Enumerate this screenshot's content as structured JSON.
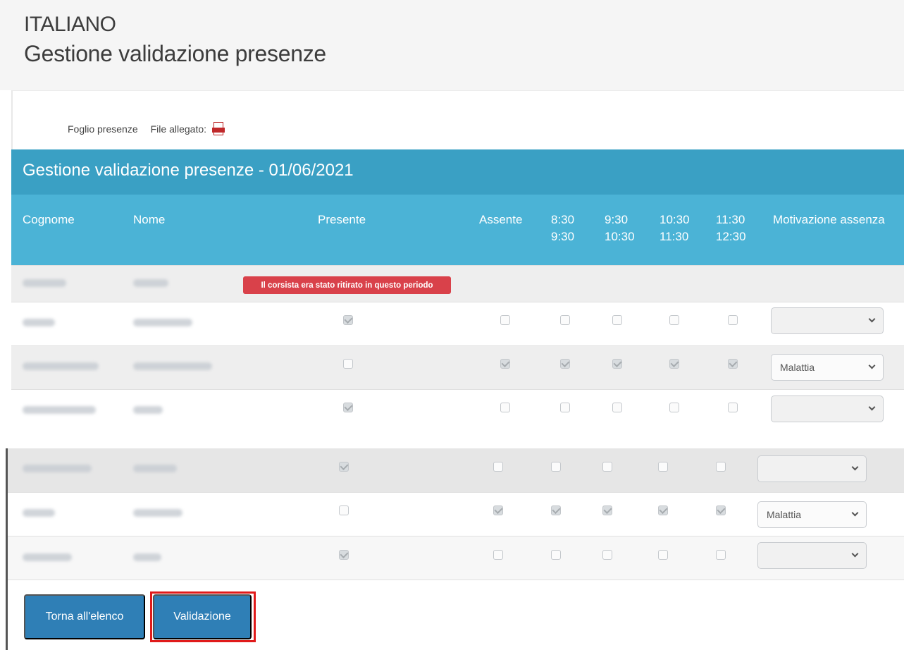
{
  "header": {
    "module": "ITALIANO",
    "title": "Gestione validazione presenze"
  },
  "files": {
    "sheet_label": "Foglio presenze",
    "attached_label": "File allegato:",
    "attached_icon": "pdf-icon"
  },
  "panel": {
    "title": "Gestione validazione presenze - 01/06/2021"
  },
  "columns": {
    "cognome": "Cognome",
    "nome": "Nome",
    "presente": "Presente",
    "assente": "Assente",
    "slots": [
      {
        "from": "8:30",
        "to": "9:30"
      },
      {
        "from": "9:30",
        "to": "10:30"
      },
      {
        "from": "10:30",
        "to": "11:30"
      },
      {
        "from": "11:30",
        "to": "12:30"
      }
    ],
    "motivazione": "Motivazione assenza"
  },
  "rows": [
    {
      "withdrawn": true,
      "badge": "Il corsista era stato ritirato in questo periodo"
    },
    {
      "presente": true,
      "assente": false,
      "slots": [
        false,
        false,
        false,
        false
      ],
      "motivazione": ""
    },
    {
      "presente": false,
      "assente": true,
      "slots": [
        true,
        true,
        true,
        true
      ],
      "motivazione": "Malattia"
    },
    {
      "presente": true,
      "assente": false,
      "slots": [
        false,
        false,
        false,
        false
      ],
      "motivazione": ""
    },
    {
      "presente": true,
      "assente": false,
      "slots": [
        false,
        false,
        false,
        false
      ],
      "motivazione": ""
    },
    {
      "presente": false,
      "assente": true,
      "slots": [
        true,
        true,
        true,
        true
      ],
      "motivazione": "Malattia"
    },
    {
      "presente": true,
      "assente": false,
      "slots": [
        false,
        false,
        false,
        false
      ],
      "motivazione": ""
    }
  ],
  "buttons": {
    "back": "Torna all'elenco",
    "validate": "Validazione"
  },
  "colors": {
    "panel_header": "#3aa0c4",
    "column_header": "#4bb3d6",
    "badge": "#d9414a",
    "button": "#2f7fb6",
    "highlight": "#e01a1a"
  }
}
